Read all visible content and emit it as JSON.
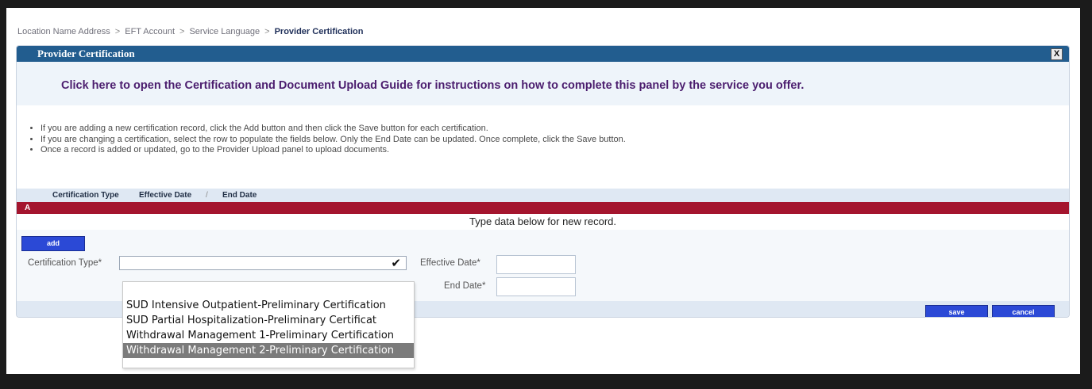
{
  "breadcrumb": {
    "items": [
      "Location Name Address",
      "EFT Account",
      "Service Language"
    ],
    "separator": ">",
    "current": "Provider Certification"
  },
  "panel": {
    "title": "Provider Certification",
    "close_label": "X",
    "guide_link": "Click here to open the Certification and Document Upload Guide for instructions on how to complete this panel by the service you offer."
  },
  "instructions": [
    "If you are adding a new certification record, click the Add button and then click the Save button for each certification.",
    "If you are changing a certification, select the row to populate the fields below. Only the End Date can be updated. Once complete, click the Save button.",
    "Once a record is added or updated, go to the Provider Upload panel to upload documents."
  ],
  "grid": {
    "columns": [
      "Certification Type",
      "Effective Date",
      "End Date"
    ],
    "sort_indicator": "/",
    "group_label": "A",
    "new_record_note": "Type data below for new record."
  },
  "form": {
    "add_label": "add",
    "cert_type_label": "Certification Type*",
    "cert_type_value": "",
    "effective_date_label": "Effective Date*",
    "effective_date_value": "",
    "end_date_label": "End Date*",
    "end_date_value": "",
    "save_label": "save",
    "cancel_label": "cancel"
  },
  "dropdown": {
    "options": [
      "SUD Intensive Outpatient-Preliminary Certification",
      "SUD Partial Hospitalization-Preliminary Certificat",
      "Withdrawal Management 1-Preliminary Certification",
      "Withdrawal Management 2-Preliminary Certification"
    ],
    "highlighted_index": 3
  },
  "icons": {
    "select_chevron": "chevron-down-icon",
    "close": "close-icon"
  },
  "colors": {
    "header_blue": "#225d8f",
    "group_red": "#a4152e",
    "button_blue": "#2b49d6",
    "guide_purple": "#4b1d6e"
  }
}
